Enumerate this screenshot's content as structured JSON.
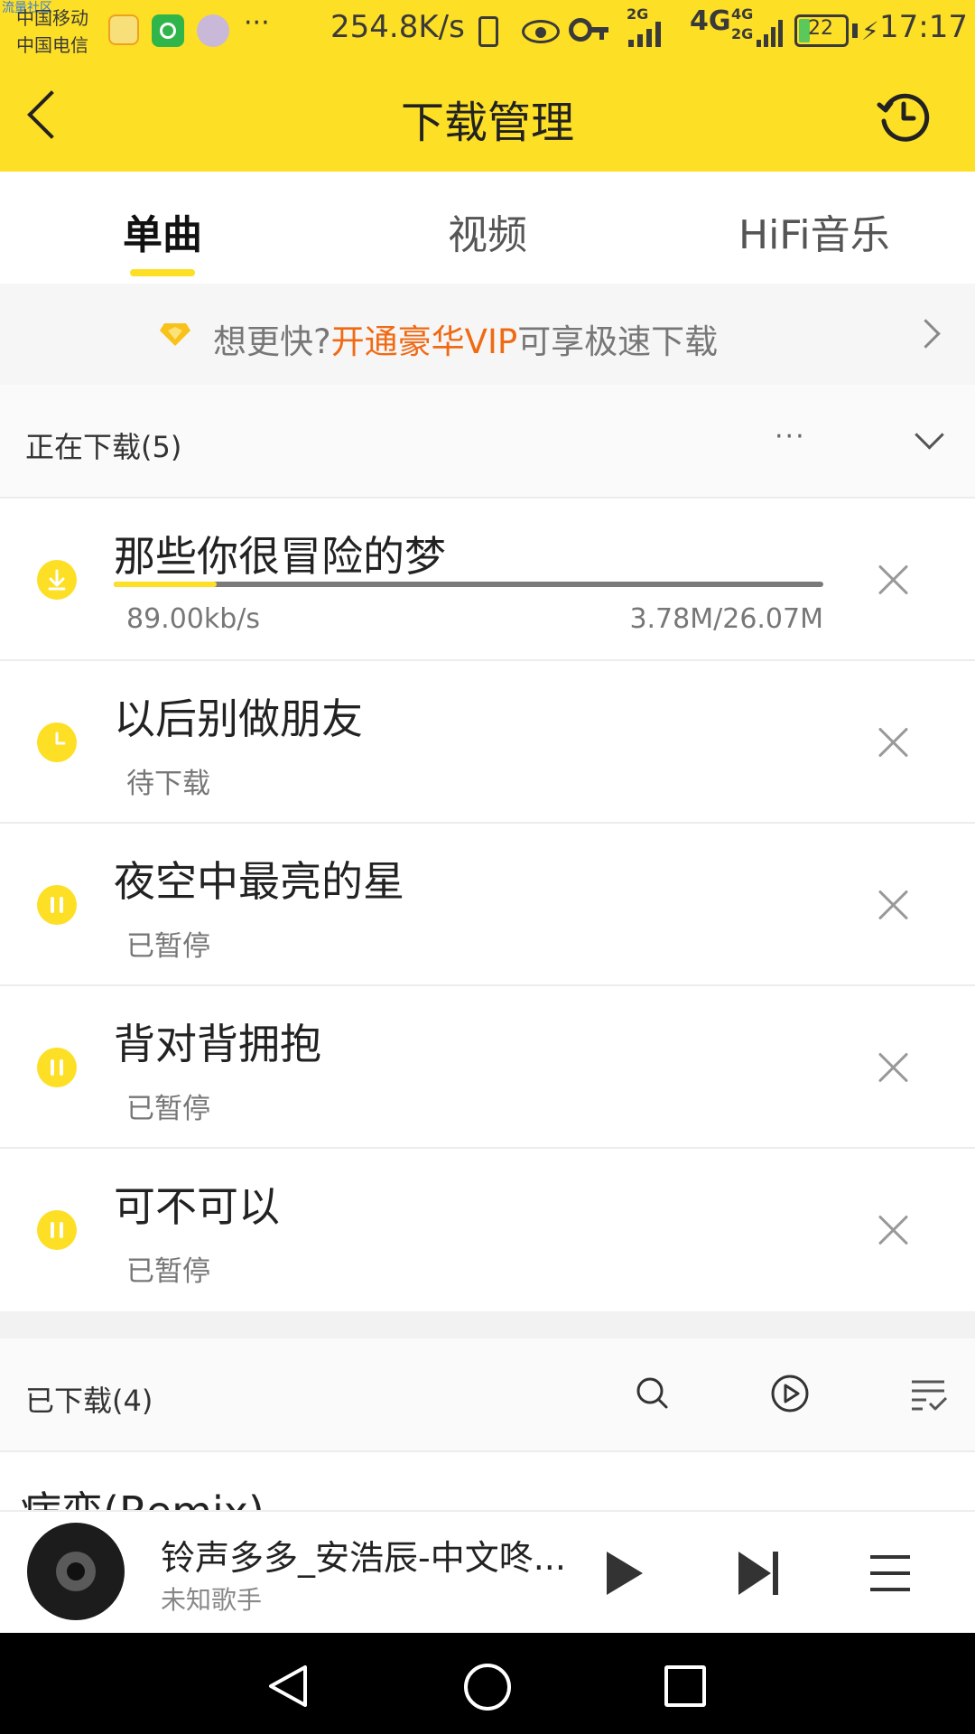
{
  "status_bar": {
    "watermark": "流量社区",
    "carrier_1": "中国移动",
    "carrier_2": "中国电信",
    "more": "···",
    "net_speed": "254.8K/s",
    "signal_2g_a": "2G",
    "signal_4g": "4G",
    "signal_4g_small": "4G",
    "signal_2g_b": "2G",
    "battery": "22",
    "time": "17:17",
    "colors": {
      "background": "#fddf25"
    }
  },
  "header": {
    "title": "下载管理",
    "back_icon": "chevron-left-icon",
    "history_icon": "history-clock-icon"
  },
  "tabs": [
    {
      "label": "单曲",
      "active": true
    },
    {
      "label": "视频",
      "active": false
    },
    {
      "label": "HiFi音乐",
      "active": false
    }
  ],
  "vip_banner": {
    "prefix": "想更快?",
    "highlight": "开通豪华VIP",
    "suffix": "可享极速下载",
    "icon": "vip-diamond-icon",
    "colors": {
      "highlight": "#f06a14"
    }
  },
  "downloading": {
    "title": "正在下载(5)",
    "more_label": "···",
    "items": [
      {
        "title": "那些你很冒险的梦",
        "status_icon": "download-icon",
        "speed": "89.00kb/s",
        "size": "3.78M/26.07M",
        "progress": 0.145
      },
      {
        "title": "以后别做朋友",
        "status_icon": "clock-icon",
        "status": "待下载"
      },
      {
        "title": "夜空中最亮的星",
        "status_icon": "pause-icon",
        "status": "已暂停"
      },
      {
        "title": "背对背拥抱",
        "status_icon": "pause-icon",
        "status": "已暂停"
      },
      {
        "title": "可不可以",
        "status_icon": "pause-icon",
        "status": "已暂停"
      }
    ]
  },
  "downloaded": {
    "title": "已下载(4)",
    "first_item_partial": "病变(Remix)"
  },
  "player": {
    "song": "铃声多多_安浩辰-中文咚...",
    "artist": "未知歌手"
  }
}
